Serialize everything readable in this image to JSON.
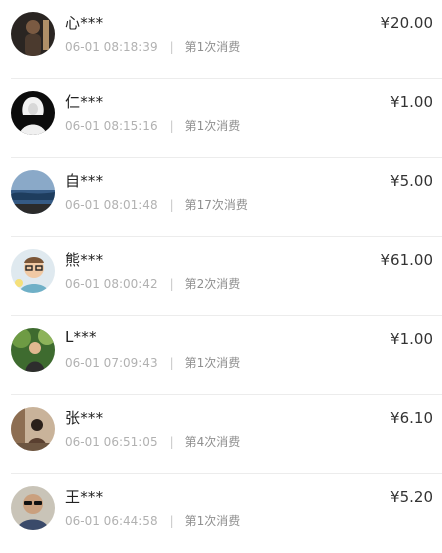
{
  "donations": [
    {
      "name": "心***",
      "time": "06-01 08:18:39",
      "times": "第1次消费",
      "amount": "¥20.00",
      "avatar": "avatar-dark-portrait"
    },
    {
      "name": "仁***",
      "time": "06-01 08:15:16",
      "times": "第1次消费",
      "amount": "¥1.00",
      "avatar": "avatar-black-white-figure"
    },
    {
      "name": "自***",
      "time": "06-01 08:01:48",
      "times": "第17次消费",
      "amount": "¥5.00",
      "avatar": "avatar-sea-landscape"
    },
    {
      "name": "熊***",
      "time": "06-01 08:00:42",
      "times": "第2次消费",
      "amount": "¥61.00",
      "avatar": "avatar-glasses-man"
    },
    {
      "name": "L***",
      "time": "06-01 07:09:43",
      "times": "第1次消费",
      "amount": "¥1.00",
      "avatar": "avatar-green-outdoor"
    },
    {
      "name": "张***",
      "time": "06-01 06:51:05",
      "times": "第4次消费",
      "amount": "¥6.10",
      "avatar": "avatar-room-person"
    },
    {
      "name": "王***",
      "time": "06-01 06:44:58",
      "times": "第1次消费",
      "amount": "¥5.20",
      "avatar": "avatar-sunglasses-man"
    }
  ]
}
